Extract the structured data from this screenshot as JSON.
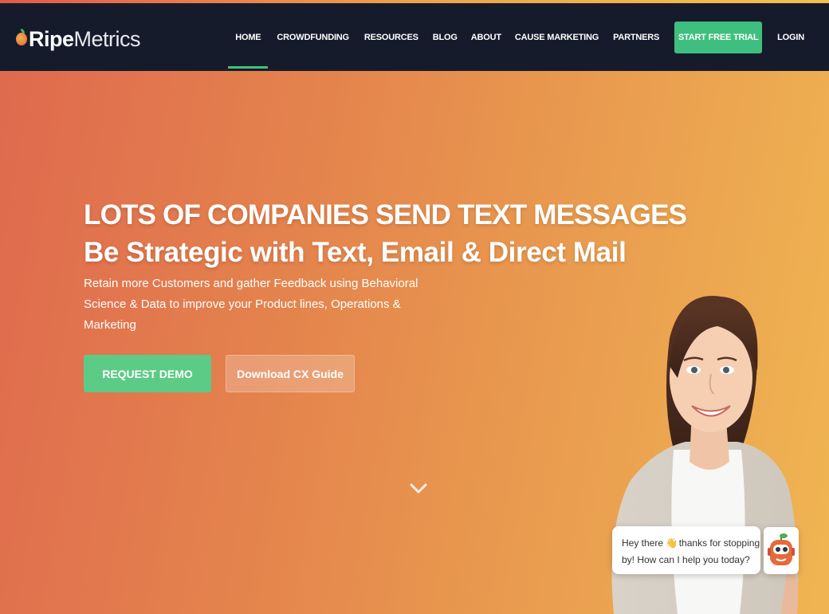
{
  "brand": {
    "name_bold": "Ripe",
    "name_light": "Metrics"
  },
  "nav": {
    "items": [
      {
        "label": "HOME"
      },
      {
        "label": "CROWDFUNDING"
      },
      {
        "label": "RESOURCES"
      },
      {
        "label": "BLOG"
      },
      {
        "label": "ABOUT"
      },
      {
        "label": "CAUSE MARKETING"
      },
      {
        "label": "PARTNERS"
      }
    ],
    "active": "HOME",
    "trial_button": "START FREE TRIAL",
    "login": "LOGIN"
  },
  "hero": {
    "headline1": "LOTS OF COMPANIES SEND TEXT MESSAGES",
    "headline2": "Be Strategic with Text, Email & Direct Mail",
    "subtext": "Retain more Customers and gather Feedback using Behavioral Science & Data to improve your Product lines, Operations & Marketing",
    "demo_button": "REQUEST DEMO",
    "guide_button": "Download CX Guide"
  },
  "chat": {
    "line1_pre": "Hey there",
    "wave_emoji": "👋",
    "line1_post": "thanks for stopping",
    "line2": "by! How can I help you today?"
  },
  "icons": {
    "scroll": "chevron-down-icon",
    "chat_avatar": "robot-icon",
    "wave": "waving-hand-icon"
  },
  "colors": {
    "nav_bg": "#161b2c",
    "accent_green": "#3fbf7f",
    "hero_left": "#df6a4e",
    "hero_right": "#f0b552"
  }
}
